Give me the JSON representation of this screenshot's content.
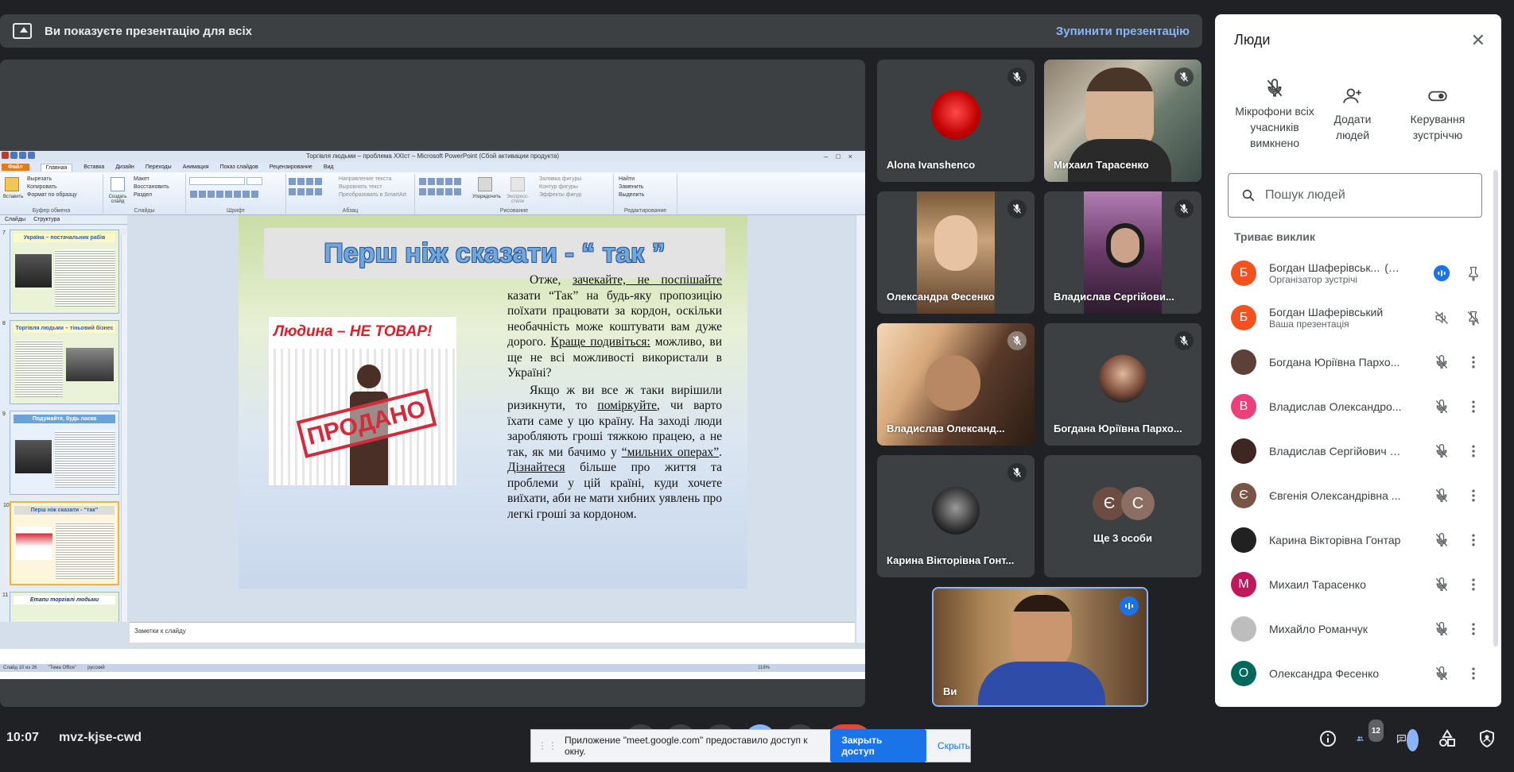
{
  "banner": {
    "title": "Ви показуєте презентацію для всіх",
    "stop_label": "Зупинити презентацію"
  },
  "ppt": {
    "window_title": "Торгівля людьми – проблема ХХІст – Microsoft PowerPoint (Сбой активации продукта)",
    "tabs": [
      "Файл",
      "Главная",
      "Вставка",
      "Дизайн",
      "Переходы",
      "Анимация",
      "Показ слайдов",
      "Рецензирование",
      "Вид"
    ],
    "ribbon": {
      "paste": "Вставить",
      "cut": "Вырезать",
      "copy": "Копировать",
      "format": "Формат по образцу",
      "clipboard_group": "Буфер обмена",
      "new_slide": "Создать слайд",
      "layout": "Макет",
      "reset": "Восстановить",
      "section": "Раздел",
      "slides_group": "Слайды",
      "font_group": "Шрифт",
      "para_group": "Абзац",
      "text_dir": "Направление текста",
      "align_text": "Выровнять текст",
      "smartart": "Преобразовать в SmartArt",
      "arrange": "Упорядочить",
      "quick_styles": "Экспресс-стили",
      "fill": "Заливка фигуры",
      "outline": "Контур фигуры",
      "effects": "Эффекты фигур",
      "drawing_group": "Рисование",
      "find": "Найти",
      "replace": "Заменить",
      "select": "Выделить",
      "editing_group": "Редактирование"
    },
    "panel_tabs": [
      "Слайды",
      "Структура"
    ],
    "thumbs": [
      {
        "num": "7",
        "title": "Україна – постачальник рабів"
      },
      {
        "num": "8",
        "title": "Торгівля людьми – тіньовий бізнес"
      },
      {
        "num": "9",
        "title": "Подумайте, будь ласка"
      },
      {
        "num": "10",
        "title": "Перш ніж сказати - “так”"
      },
      {
        "num": "11",
        "title": "Етапи торгівлі людьми"
      }
    ],
    "slide": {
      "title": "Перш ніж сказати - “ так ”",
      "image_heading": "Людина – НЕ ТОВАР!",
      "stamp": "ПРОДАНО",
      "para1_pre": "Отже, ",
      "para1_u": "зачекайте, не поспішайте",
      "para1_post": " казати “Так” на будь-яку пропозицію поїхати працювати за кордон, оскільки необачність може коштувати вам дуже дорого. ",
      "para1_u2": "Краще подивіться:",
      "para1_end": " можливо, ви ще не всі можливості використали в Україні?",
      "para2_pre": "Якщо ж ви все ж таки вирішили ризикнути, то ",
      "para2_u": "поміркуйте",
      "para2_mid": ", чи варто їхати саме у цю країну. На заході люди заробляють гроші тяжкою працею, а не так, як ми бачимо у ",
      "para2_u2": "“мильних операх”",
      "para2_mid2": ". ",
      "para2_u3": "Дізнайтеся",
      "para2_end": " більше про життя та проблеми у цій країні, куди хочете виїхати, аби не мати хибних уявлень про легкі гроші за кордоном."
    },
    "notes": "Заметки к слайду",
    "status": [
      "Слайд 10 из 26",
      "\"Тема Office\"",
      "русский",
      "118%"
    ]
  },
  "tiles": [
    {
      "name": "Alona Ivanshenco",
      "muted": true
    },
    {
      "name": "Михаил Тарасенко",
      "muted": true
    },
    {
      "name": "Олександра Фесенко",
      "muted": true
    },
    {
      "name": "Владислав Сергійови...",
      "muted": true
    },
    {
      "name": "Владислав Олександ...",
      "muted": true
    },
    {
      "name": "Богдана Юріївна Пархо...",
      "muted": true
    },
    {
      "name": "Карина Вікторівна Гонт...",
      "muted": true
    },
    {
      "name": "Ще 3 особи",
      "avatars": [
        "Є",
        "С"
      ]
    },
    {
      "name": "Ви"
    }
  ],
  "panel": {
    "title": "Люди",
    "actions": [
      {
        "label": "Мікрофони всіх учасників вимкнено",
        "icon": "mic-off-icon"
      },
      {
        "label": "Додати людей",
        "icon": "add-person-icon"
      },
      {
        "label": "Керування зустріччю",
        "icon": "toggle-icon"
      }
    ],
    "search_placeholder": "Пошук людей",
    "section": "Триває виклик",
    "people": [
      {
        "initial": "Б",
        "color": "#f4511e",
        "name": "Богдан Шаферівськ...",
        "suffix": "(Ви)",
        "sub": "Організатор зустрічі",
        "icons": [
          "speaking",
          "pin"
        ]
      },
      {
        "initial": "Б",
        "color": "#f4511e",
        "name": "Богдан Шаферівський",
        "sub": "Ваша презентація",
        "icons": [
          "audio-off",
          "pin-off"
        ]
      },
      {
        "initial": "",
        "color": "#5d4037",
        "name": "Богдана Юріївна Пархо...",
        "icons": [
          "mic-off",
          "more"
        ]
      },
      {
        "initial": "В",
        "color": "#ec407a",
        "name": "Владислав Олександро...",
        "icons": [
          "mic-off",
          "more"
        ]
      },
      {
        "initial": "",
        "color": "#3e2723",
        "name": "Владислав Сергійович Б...",
        "icons": [
          "mic-off",
          "more"
        ]
      },
      {
        "initial": "Є",
        "color": "#795548",
        "name": "Євгенія Олександрівна ...",
        "icons": [
          "mic-off",
          "more"
        ]
      },
      {
        "initial": "",
        "color": "#212121",
        "name": "Карина Вікторівна Гонтар",
        "icons": [
          "mic-off",
          "more"
        ]
      },
      {
        "initial": "М",
        "color": "#c2185b",
        "name": "Михаил Тарасенко",
        "icons": [
          "mic-off",
          "more"
        ]
      },
      {
        "initial": "",
        "color": "#bdbdbd",
        "name": "Михайло Романчук",
        "icons": [
          "mic-off",
          "more"
        ]
      },
      {
        "initial": "О",
        "color": "#00695c",
        "name": "Олександра Фесенко",
        "icons": [
          "mic-off",
          "more"
        ]
      }
    ]
  },
  "bottom": {
    "time": "10:07",
    "code": "mvz-kjse-cwd",
    "share_text": "Приложение \"meet.google.com\" предоставило доступ к окну.",
    "share_button": "Закрыть доступ",
    "hide_button": "Скрыть",
    "people_count": "12"
  },
  "colors": {
    "accent": "#8ab4f8",
    "background": "#202124",
    "tile": "#3c4043",
    "share_blue": "#1a73e8"
  }
}
